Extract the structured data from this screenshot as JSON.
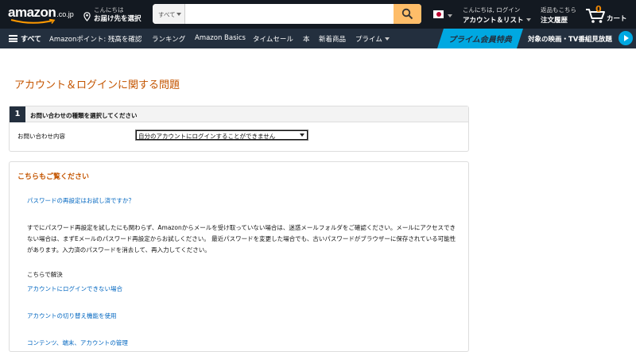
{
  "header": {
    "logo_text": "amazon",
    "logo_tld": ".co.jp",
    "deliver_line1": "こんにちは",
    "deliver_line2": "お届け先を選択",
    "search_category": "すべて",
    "search_placeholder": "",
    "account_line1": "こんにちは, ログイン",
    "account_line2": "アカウント＆リスト",
    "orders_line1": "返品もこちら",
    "orders_line2": "注文履歴",
    "cart_count": "0",
    "cart_label": "カート"
  },
  "subnav": {
    "all_label": "すべて",
    "links": [
      "Amazonポイント: 残高を確認",
      "ランキング",
      "Amazon Basics",
      "タイムセール",
      "本",
      "新着商品",
      "プライム"
    ],
    "prime_banner": "プライム会員特典",
    "promo": "対象の映画・TV番組見放題"
  },
  "main": {
    "title": "アカウント＆ログインに関する問題",
    "step": {
      "number": "1",
      "heading": "お問い合わせの種類を選択してください",
      "field_label": "お問い合わせ内容",
      "selected_value": "自分のアカウントにログインすることができません"
    },
    "help": {
      "title": "こちらもご覧ください",
      "link_password": "パスワードの再設定はお試し済ですか？",
      "paragraph": "すでにパスワード再設定を試したにも関わらず、Amazonからメールを受け取っていない場合は、迷惑メールフォルダをご確認ください。メールにアクセスできない場合は、まずEメールのパスワード再設定からお試しください。 最近パスワードを変更した場合でも、古いパスワードがブラウザーに保存されている可能性があります。入力済のパスワードを消去して、再入力してください。",
      "resolve_label": "こちらで解決",
      "link_cannot_login": "アカウントにログインできない場合",
      "link_switch": "アカウントの切り替え機能を使用",
      "link_content": "コンテンツ、端末、アカウントの管理"
    }
  }
}
